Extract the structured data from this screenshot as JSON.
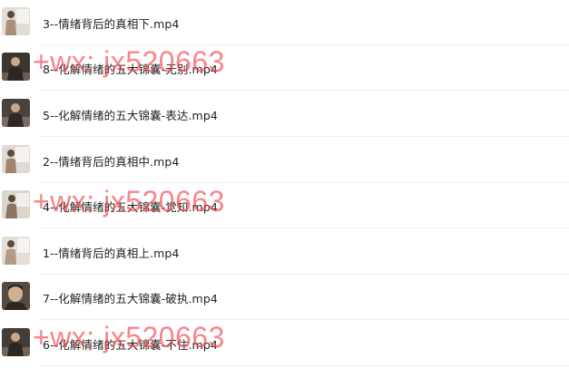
{
  "files": [
    {
      "name": "3--情绪背后的真相下.mp4",
      "thumb_style": "light"
    },
    {
      "name": "8--化解情绪的五大锦囊-无别.mp4",
      "thumb_style": "dark"
    },
    {
      "name": "5--化解情绪的五大锦囊-表达.mp4",
      "thumb_style": "dark"
    },
    {
      "name": "2--情绪背后的真相中.mp4",
      "thumb_style": "light"
    },
    {
      "name": "4--化解情绪的五大锦囊-觉知.mp4",
      "thumb_style": "light"
    },
    {
      "name": "1--情绪背后的真相上.mp4",
      "thumb_style": "light"
    },
    {
      "name": "7--化解情绪的五大锦囊-破执.mp4",
      "thumb_style": "face"
    },
    {
      "name": "6--化解情绪的五大锦囊-不住.mp4",
      "thumb_style": "dark"
    }
  ],
  "watermarks": [
    {
      "text": "+wx: jx520663"
    },
    {
      "text": "+wx: jx520663"
    },
    {
      "text": "+wx: jx520663"
    }
  ],
  "colors": {
    "watermark": "#f5464f",
    "text": "#1f1f1f",
    "divider": "#f0f0f0"
  }
}
